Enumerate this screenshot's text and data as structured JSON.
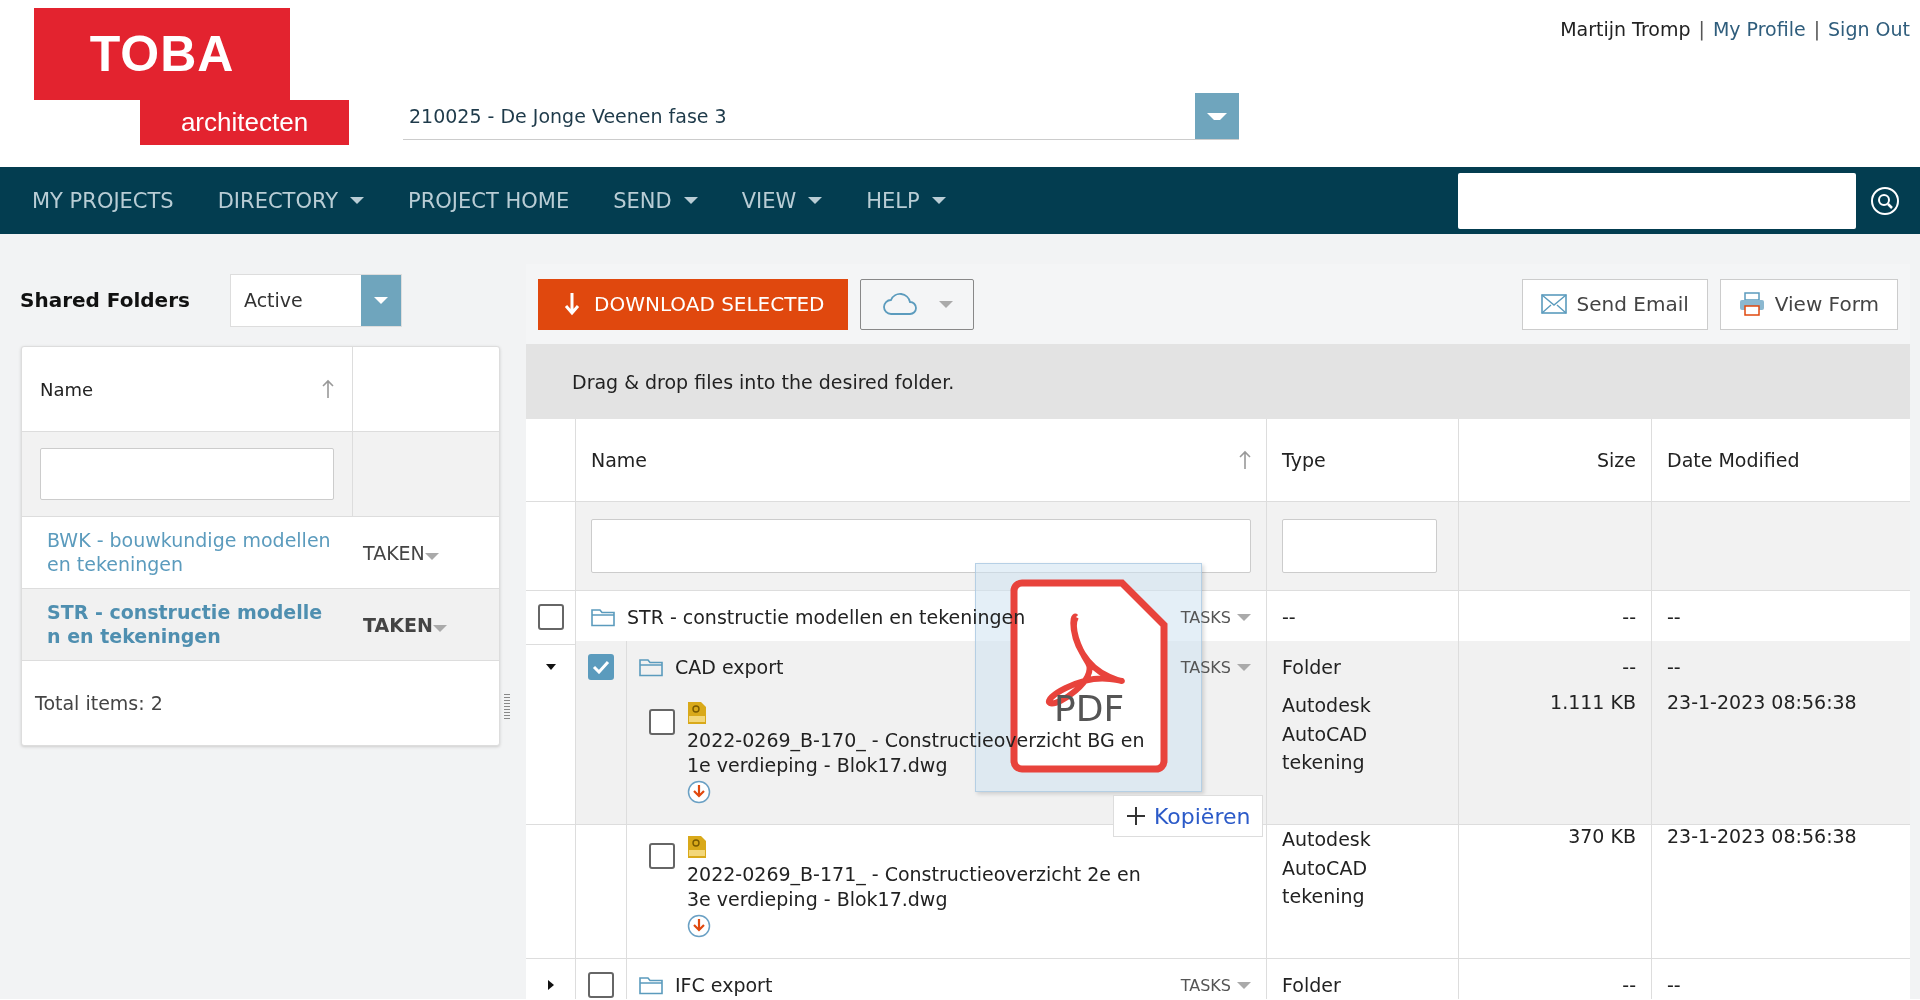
{
  "header": {
    "logo": {
      "wordmark": "TOBA",
      "subtitle": "architecten"
    },
    "project_selector": {
      "value": "210025 - De Jonge Veenen fase 3"
    },
    "user": {
      "name": "Martijn Tromp",
      "separator": "|",
      "links": [
        "My Profile",
        "Sign Out"
      ]
    }
  },
  "nav": {
    "items": [
      {
        "label": "MY PROJECTS",
        "dropdown": false
      },
      {
        "label": "DIRECTORY",
        "dropdown": true
      },
      {
        "label": "PROJECT HOME",
        "dropdown": false
      },
      {
        "label": "SEND",
        "dropdown": true
      },
      {
        "label": "VIEW",
        "dropdown": true
      },
      {
        "label": "HELP",
        "dropdown": true
      }
    ]
  },
  "shared_folders": {
    "title": "Shared Folders",
    "status_filter": "Active",
    "columns": [
      "Name"
    ],
    "rows": [
      {
        "name": "BWK - bouwkundige modellen en tekeningen",
        "action": "TAKEN",
        "selected": false
      },
      {
        "name": "STR - constructie modellen en tekeningen",
        "action": "TAKEN",
        "selected": true
      }
    ],
    "footer": "Total items: 2"
  },
  "files": {
    "toolbar": {
      "download": "DOWNLOAD SELECTED",
      "send_email": "Send Email",
      "view_form": "View Form"
    },
    "hint": "Drag & drop files into the desired folder.",
    "columns": [
      "Name",
      "Type",
      "Size",
      "Date Modified"
    ],
    "rows": [
      {
        "kind": "folder",
        "name": "STR - constructie modellen en tekeningen",
        "action": "TASKS",
        "type": "--",
        "size": "--",
        "modified": "--",
        "checked": false
      },
      {
        "kind": "subfolder",
        "name": "CAD export",
        "action": "TASKS",
        "type": "Folder",
        "size": "--",
        "modified": "--",
        "checked": true,
        "expanded": true,
        "children": [
          {
            "kind": "file",
            "name": "2022-0269_B-170_ - Constructieoverzicht BG en 1e verdieping - Blok17.dwg",
            "type": "Autodesk AutoCAD tekening",
            "size": "1.111 KB",
            "modified": "23-1-2023 08:56:38",
            "checked": false,
            "hovered": true
          },
          {
            "kind": "file",
            "name": "2022-0269_B-171_ - Constructieoverzicht 2e en 3e verdieping - Blok17.dwg",
            "type": "Autodesk AutoCAD tekening",
            "size": "370 KB",
            "modified": "23-1-2023 08:56:38",
            "checked": false,
            "hovered": false
          }
        ]
      },
      {
        "kind": "subfolder",
        "name": "IFC export",
        "action": "TASKS",
        "type": "Folder",
        "size": "--",
        "modified": "--",
        "checked": false,
        "expanded": false
      }
    ]
  },
  "drag_preview": {
    "label": "PDF",
    "drop_action": "Kopiëren"
  }
}
